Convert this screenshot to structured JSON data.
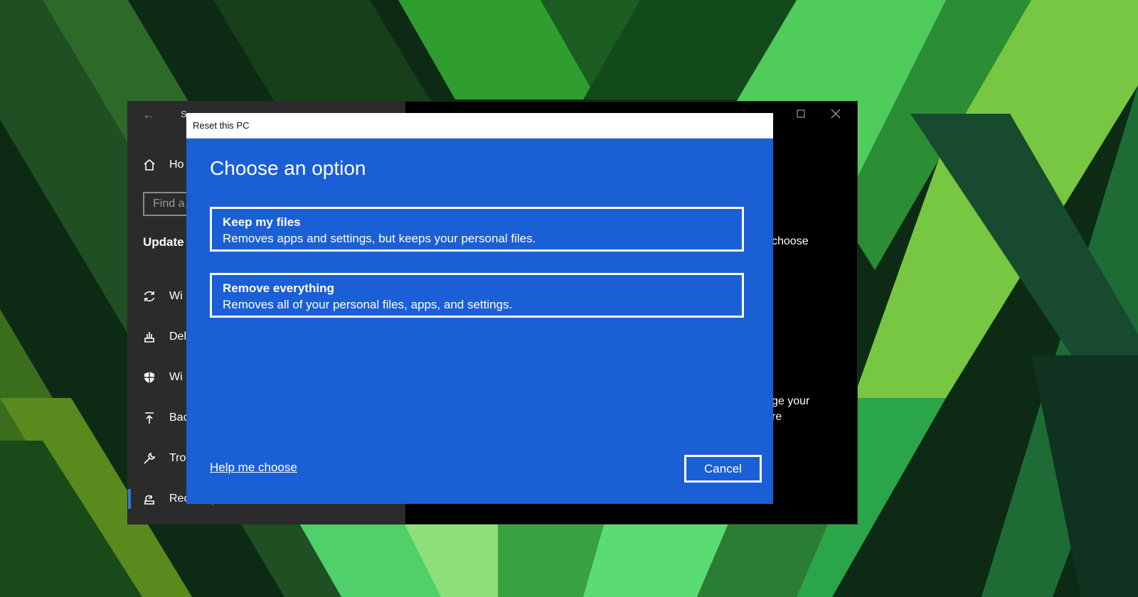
{
  "settings": {
    "title_partial": "S",
    "search_placeholder": "Find a",
    "section_title": "Update",
    "nav": [
      {
        "label": "Ho",
        "icon": "home-icon"
      },
      {
        "label": "Wi",
        "icon": "sync-icon"
      },
      {
        "label": "Del",
        "icon": "delivery-optimization-icon"
      },
      {
        "label": "Wi",
        "icon": "shield-icon"
      },
      {
        "label": "Bac",
        "icon": "backup-arrow-icon"
      },
      {
        "label": "Tro",
        "icon": "wrench-icon"
      },
      {
        "label": "Recovery",
        "icon": "recovery-icon"
      }
    ],
    "right_fragments": [
      "choose",
      "ge your",
      "re"
    ]
  },
  "dialog": {
    "title": "Reset this PC",
    "heading": "Choose an option",
    "options": [
      {
        "title": "Keep my files",
        "description": "Removes apps and settings, but keeps your personal files."
      },
      {
        "title": "Remove everything",
        "description": "Removes all of your personal files, apps, and settings."
      }
    ],
    "help_link": "Help me choose",
    "cancel_label": "Cancel"
  },
  "colors": {
    "dialog_blue": "#1b5fd6",
    "accent": "#2f7bd4",
    "sidebar": "#2b2b2b"
  }
}
